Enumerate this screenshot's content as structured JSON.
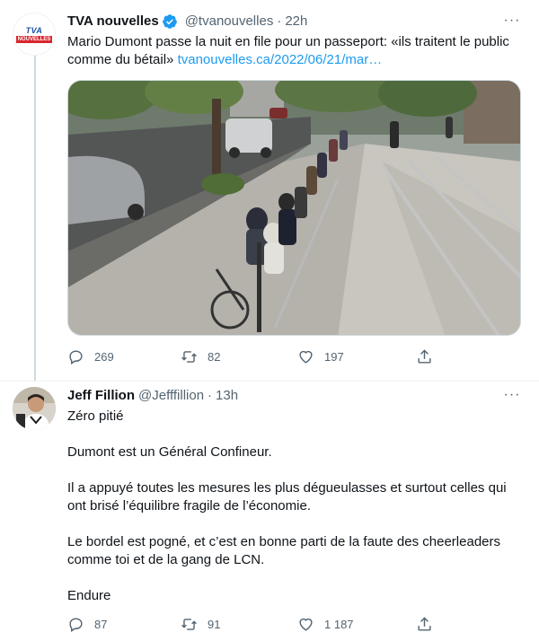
{
  "tweet1": {
    "name": "TVA nouvelles",
    "handle": "@tvanouvelles",
    "separator": "·",
    "time": "22h",
    "avatar_text": "TVA",
    "avatar_subtext": "NOUVELLES",
    "text": "Mario Dumont passe la nuit en file pour un passeport: «ils traitent le public comme du bétail»",
    "link": "tvanouvelles.ca/2022/06/21/mar…",
    "replies": "269",
    "retweets": "82",
    "likes": "197",
    "more": "···"
  },
  "tweet2": {
    "name": "Jeff Fillion",
    "handle": "@Jefffillion",
    "separator": "·",
    "time": "13h",
    "paragraphs": [
      "Zéro pitié",
      "Dumont est un Général Confineur.",
      "Il a appuyé toutes les mesures les plus dégueulasses et surtout celles qui ont brisé l’équilibre fragile de l’économie.",
      "Le bordel est pogné, et c’est en bonne parti de la faute des cheerleaders comme toi et de la gang de LCN.",
      "Endure"
    ],
    "replies": "87",
    "retweets": "91",
    "likes": "1 187",
    "more": "···"
  },
  "colors": {
    "accent": "#1d9bf0",
    "secondary_text": "#536471",
    "primary_text": "#0f1419",
    "border": "#cfd9de"
  },
  "icons": [
    "verified-badge-icon",
    "more-icon",
    "reply-icon",
    "retweet-icon",
    "like-icon",
    "share-icon"
  ]
}
